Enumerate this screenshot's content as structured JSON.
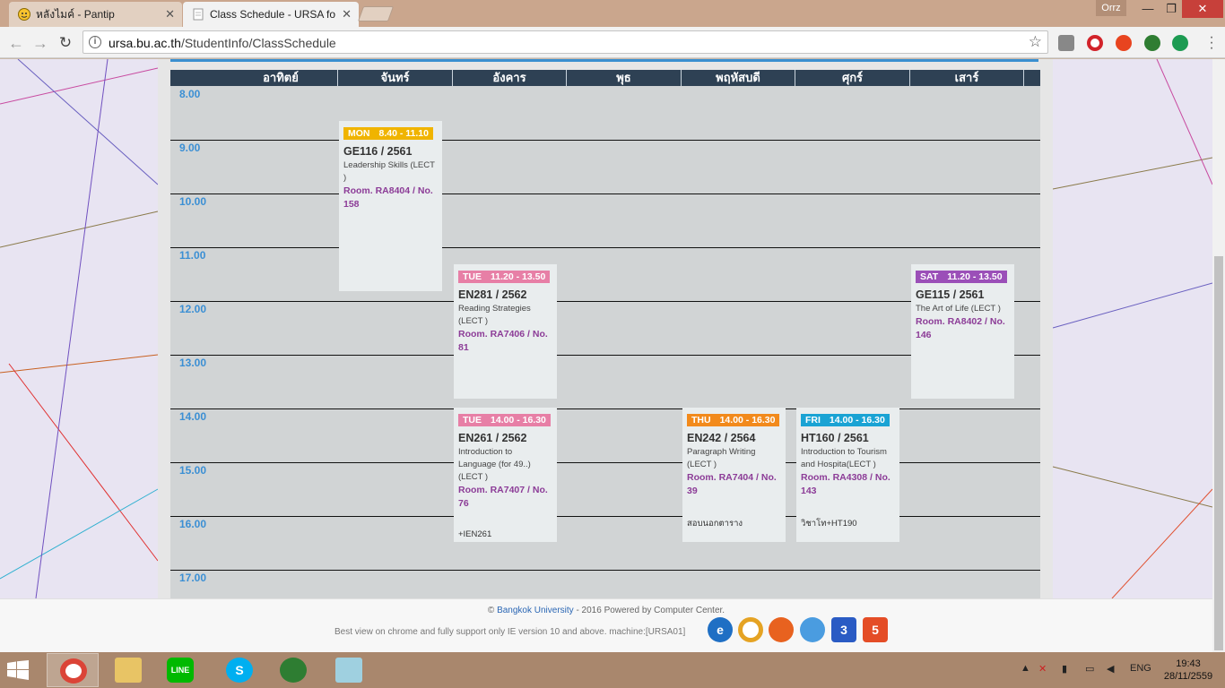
{
  "browser": {
    "tabs": [
      {
        "title": "หลังไมค์ - Pantip",
        "active": false
      },
      {
        "title": "Class Schedule - URSA fo",
        "active": true
      }
    ],
    "profile": "Orrz",
    "url_host": "ursa.bu.ac.th",
    "url_path": "/StudentInfo/ClassSchedule"
  },
  "schedule": {
    "days": [
      "อาทิตย์",
      "จันทร์",
      "อังคาร",
      "พุธ",
      "พฤหัสบดี",
      "ศุกร์",
      "เสาร์"
    ],
    "times": [
      "8.00",
      "9.00",
      "10.00",
      "11.00",
      "12.00",
      "13.00",
      "14.00",
      "15.00",
      "16.00",
      "17.00"
    ],
    "classes": [
      {
        "day": "MON",
        "time": "8.40 - 11.10",
        "code": "GE116 / 2561",
        "title": "Leadership Skills (LECT )",
        "room": "Room. RA8404 / No. 158",
        "note": "",
        "color": "#f0b400"
      },
      {
        "day": "TUE",
        "time": "11.20 - 13.50",
        "code": "EN281 / 2562",
        "title": "Reading Strategies (LECT )",
        "room": "Room. RA7406 / No. 81",
        "note": "",
        "color": "#e77fa6"
      },
      {
        "day": "SAT",
        "time": "11.20 - 13.50",
        "code": "GE115 / 2561",
        "title": "The Art of Life (LECT )",
        "room": "Room. RA8402 / No. 146",
        "note": "",
        "color": "#9b4fb8"
      },
      {
        "day": "TUE",
        "time": "14.00 - 16.30",
        "code": "EN261 / 2562",
        "title": "Introduction to Language (for 49..) (LECT )",
        "room": "Room. RA7407 / No. 76",
        "note": "+IEN261",
        "color": "#e77fa6"
      },
      {
        "day": "THU",
        "time": "14.00 - 16.30",
        "code": "EN242 / 2564",
        "title": "Paragraph Writing (LECT )",
        "room": "Room. RA7404 / No. 39",
        "note": "สอบนอกตาราง",
        "color": "#f28a1c"
      },
      {
        "day": "FRI",
        "time": "14.00 - 16.30",
        "code": "HT160 / 2561",
        "title": "Introduction to Tourism and Hospita(LECT )",
        "room": "Room. RA4308 / No. 143",
        "note": "วิชาโท+HT190",
        "color": "#1aa3d4"
      }
    ]
  },
  "footer": {
    "copyright_prefix": "©",
    "university": "Bangkok University",
    "copyright_suffix": "- 2016 Powered by Computer Center.",
    "best_view": "Best view on chrome and fully support only IE version 10 and above. machine:[URSA01]"
  },
  "taskbar": {
    "language": "ENG",
    "time": "19:43",
    "date": "28/11/2559"
  }
}
